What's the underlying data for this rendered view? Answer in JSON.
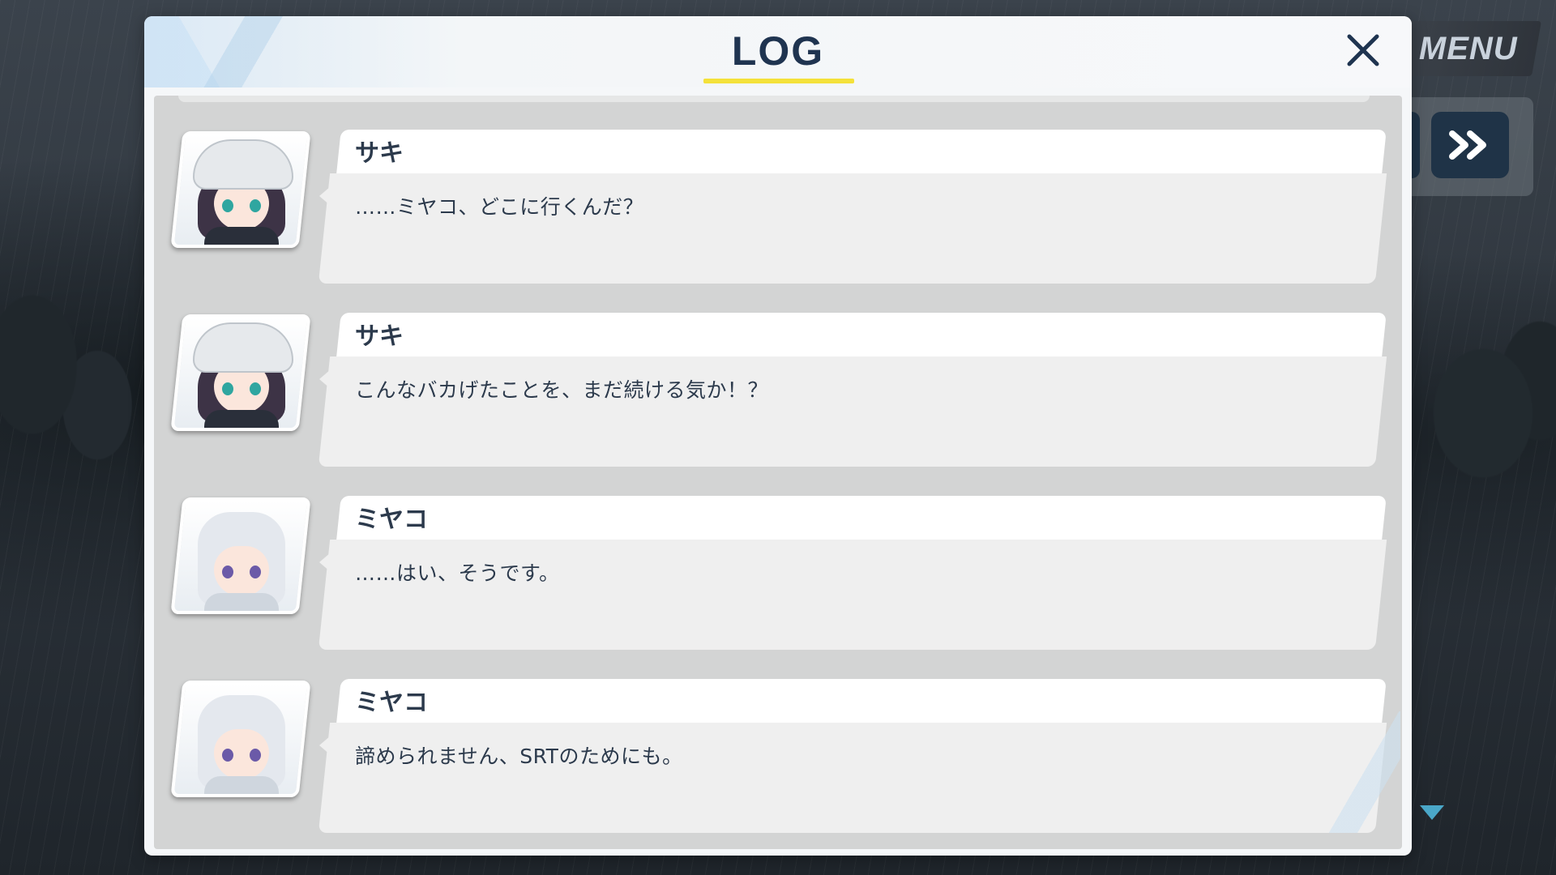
{
  "window": {
    "title": "LOG"
  },
  "hud": {
    "menu_label": "MENU",
    "fast_forward_icon": "double-chevron-right-icon",
    "close_icon": "close-icon",
    "scroll_indicator_icon": "triangle-down-icon"
  },
  "colors": {
    "title": "#1f3450",
    "underline": "#f4e13a",
    "button_dark": "#1f3347",
    "scroll_arrow": "#4aa7c8"
  },
  "log": {
    "entries": [
      {
        "speaker": "サキ",
        "text": "……ミヤコ、どこに行くんだ？",
        "avatar": "saki-avatar"
      },
      {
        "speaker": "サキ",
        "text": "こんなバカげたことを、まだ続ける気か！？",
        "avatar": "saki-avatar"
      },
      {
        "speaker": "ミヤコ",
        "text": "……はい、そうです。",
        "avatar": "miyako-avatar"
      },
      {
        "speaker": "ミヤコ",
        "text": "諦められません、SRTのためにも。",
        "avatar": "miyako-avatar"
      }
    ]
  }
}
